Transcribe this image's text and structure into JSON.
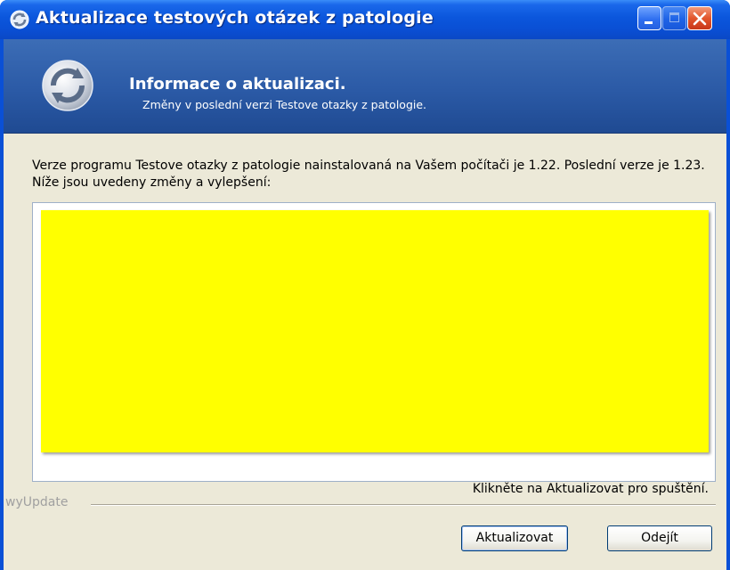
{
  "window": {
    "title": "Aktualizace testových otázek z patologie",
    "icon": "update-refresh-icon"
  },
  "titlebar_buttons": {
    "minimize": "minimize-icon",
    "maximize": "maximize-icon",
    "close": "close-icon"
  },
  "header": {
    "title": "Informace o aktualizaci.",
    "subtitle": "Změny v poslední verzi Testove otazky z patologie.",
    "icon": "update-refresh-icon"
  },
  "main": {
    "description": "Verze programu Testove otazky z patologie nainstalovaná na Vašem počítači je 1.22. Poslední verze je 1.23. Níže jsou uvedeny změny a vylepšení:",
    "changes_background": "#ffff00"
  },
  "footer": {
    "status": "Klikněte na Aktualizovat pro spuštění.",
    "brand": "wyUpdate",
    "update_button": "Aktualizovat",
    "exit_button": "Odejít"
  },
  "colors": {
    "titlebar": "#0a50d6",
    "header": "#2b5aa6",
    "client": "#ece9d8",
    "changes_highlight": "#ffff00"
  }
}
